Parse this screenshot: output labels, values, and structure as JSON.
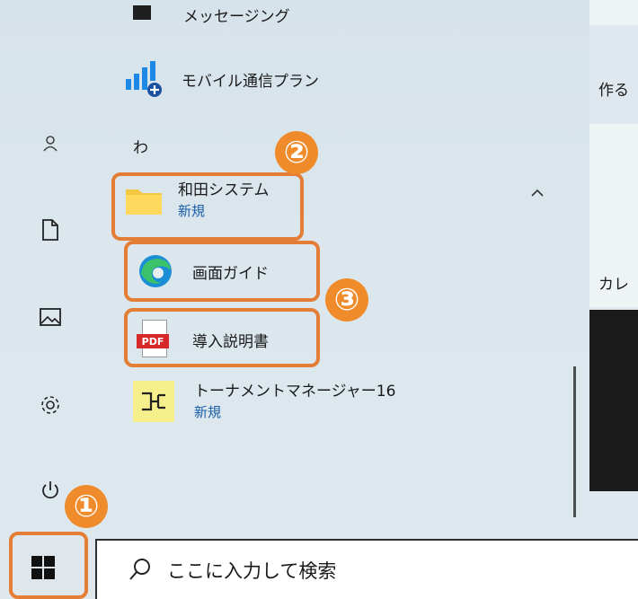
{
  "apps": {
    "messaging": "メッセージング",
    "mobile_plan": "モバイル通信プラン",
    "section_letter": "わ",
    "folder": {
      "name": "和田システム",
      "badge": "新規"
    },
    "screen_guide": "画面ガイド",
    "manual": "導入説明書",
    "tournament": {
      "name": "トーナメントマネージャー16",
      "badge": "新規"
    }
  },
  "tiles": {
    "create": "作る",
    "calendar": "カレ"
  },
  "steps": {
    "one": "①",
    "two": "②",
    "three": "③"
  },
  "search": {
    "placeholder": "ここに入力して検索"
  },
  "pdf_icon_text": "PDF",
  "colors": {
    "accent": "#e47e36",
    "step_fill": "#f08b2c",
    "new_badge": "#1a5fa8"
  }
}
